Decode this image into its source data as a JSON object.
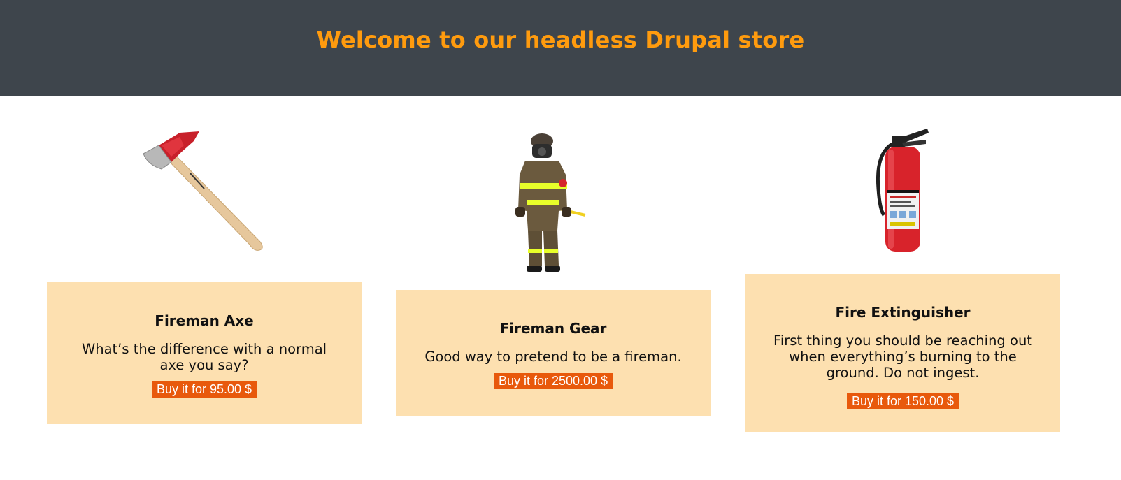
{
  "header": {
    "title": "Welcome to our headless Drupal store",
    "title_color": "#ff9b0e",
    "background": "#3e454c"
  },
  "products": [
    {
      "name": "Fireman Axe",
      "description": "What’s the difference with a normal axe you say?",
      "buy_label": "Buy it for 95.00 $",
      "image": "fireman-axe"
    },
    {
      "name": "Fireman Gear",
      "description": "Good way to pretend to be a fireman.",
      "buy_label": "Buy it for 2500.00 $",
      "image": "fireman-in-gear"
    },
    {
      "name": "Fire Extinguisher",
      "description": "First thing you should be reaching out when everything’s burning to the ground. Do not ingest.",
      "buy_label": "Buy it for 150.00 $",
      "image": "fire-extinguisher"
    }
  ],
  "colors": {
    "card_background": "#fde0b0",
    "button_background": "#e8590c"
  }
}
